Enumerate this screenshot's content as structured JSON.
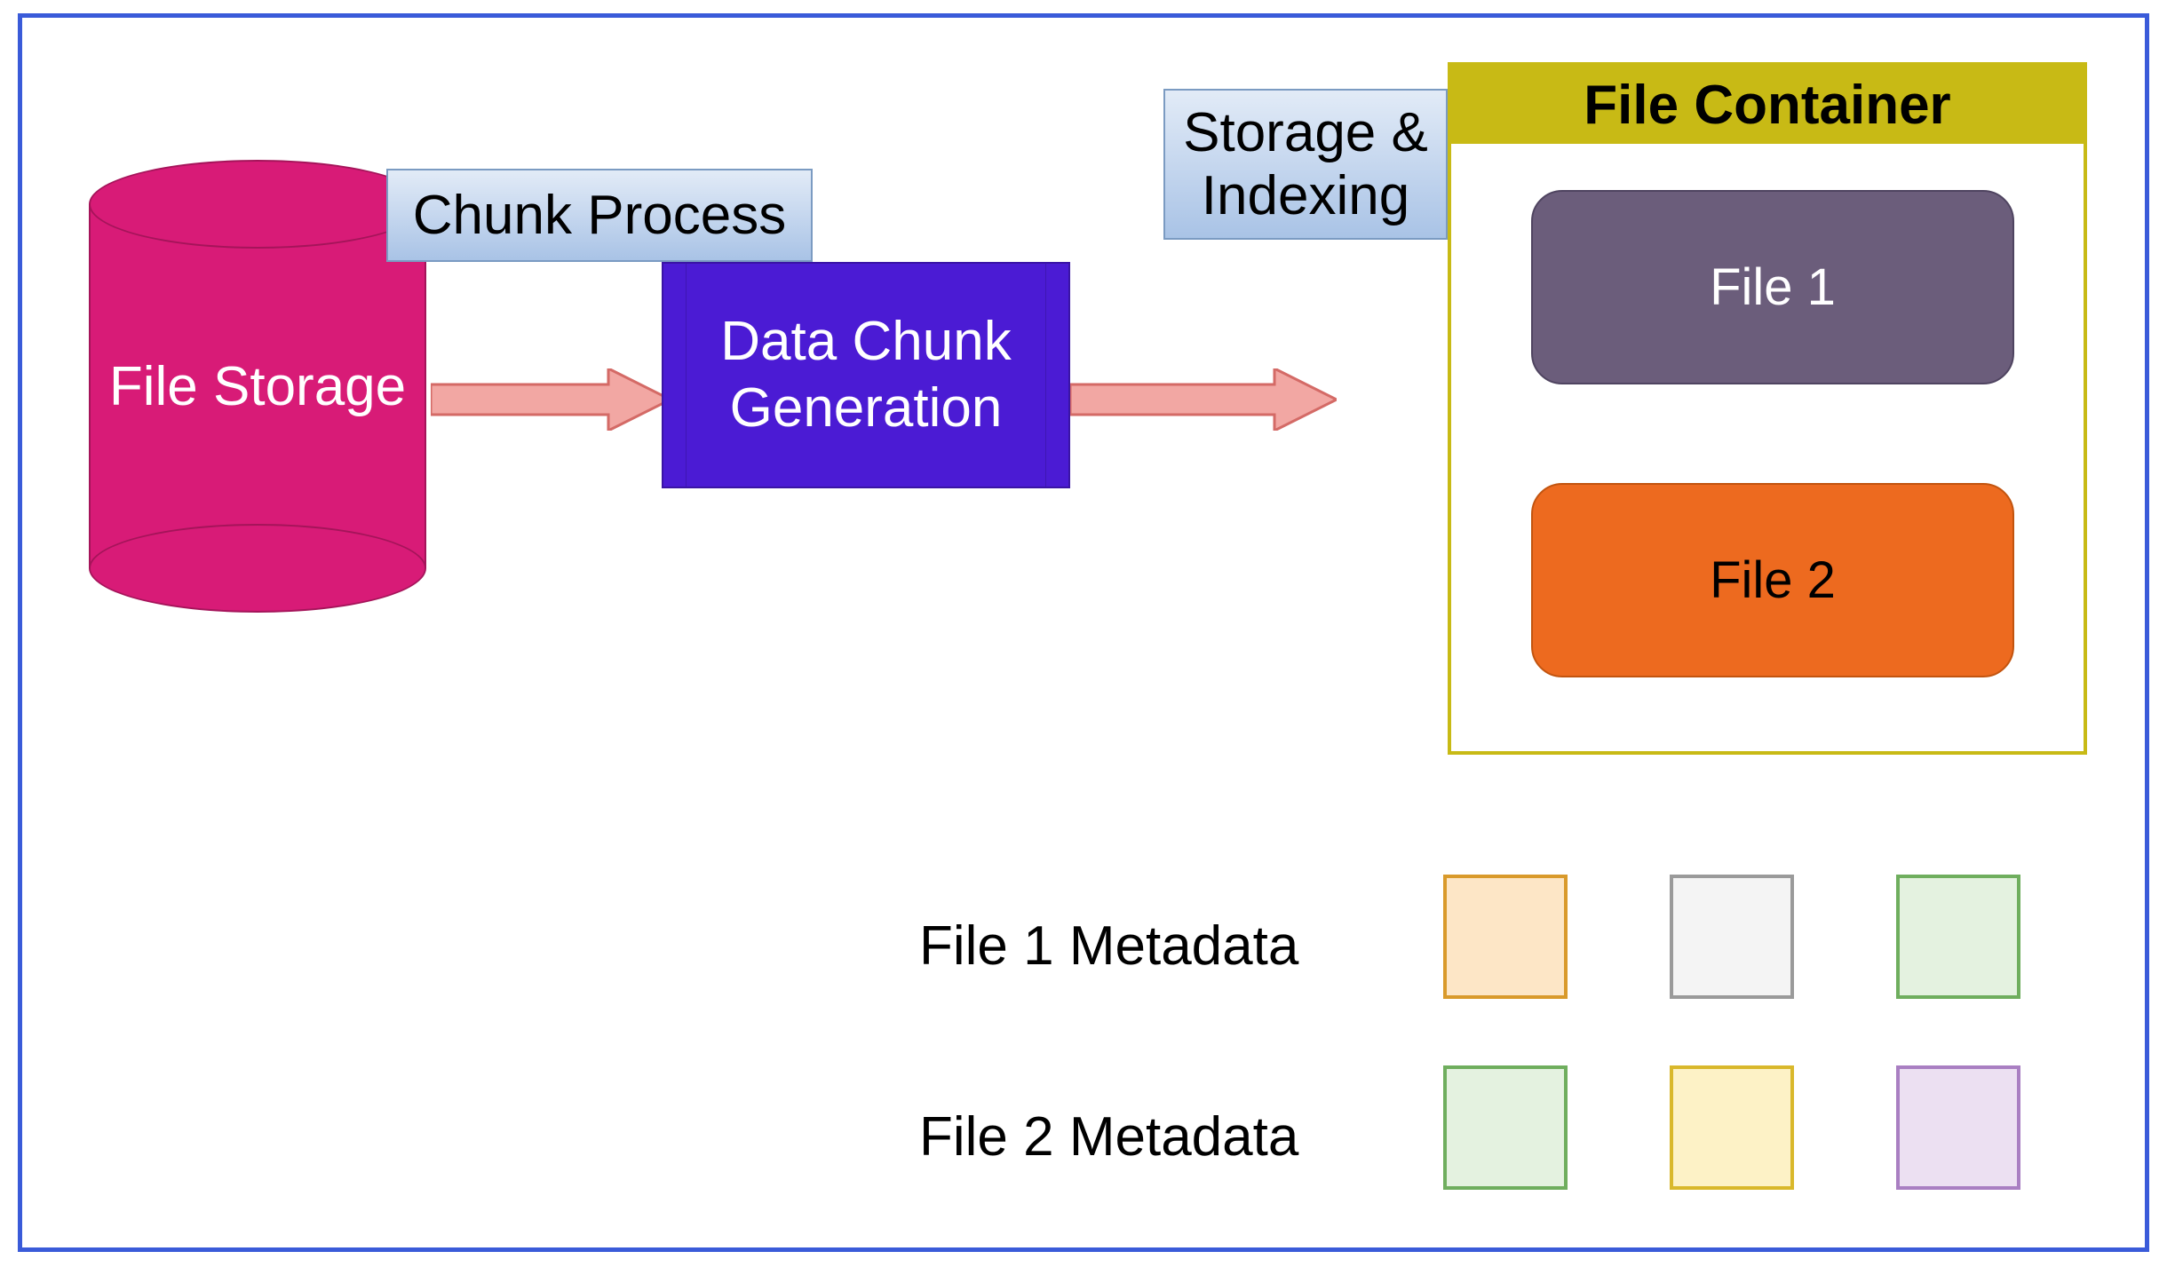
{
  "nodes": {
    "file_storage": "File Storage",
    "chunk_process": "Chunk Process",
    "data_chunk_generation": "Data Chunk\nGeneration",
    "storage_indexing": "Storage &\nIndexing",
    "file_container_title": "File Container",
    "file1": "File 1",
    "file2": "File 2"
  },
  "metadata": {
    "file1_label": "File 1 Metadata",
    "file2_label": "File 2 Metadata",
    "file1_swatches": [
      {
        "fill": "#fde6c6",
        "stroke": "#d99a2b"
      },
      {
        "fill": "#f4f4f4",
        "stroke": "#9a9a9a"
      },
      {
        "fill": "#e4f2e0",
        "stroke": "#6fae5e"
      }
    ],
    "file2_swatches": [
      {
        "fill": "#e4f2e0",
        "stroke": "#6fae5e"
      },
      {
        "fill": "#fdf2c6",
        "stroke": "#d9b82b"
      },
      {
        "fill": "#ece0f2",
        "stroke": "#a97fc2"
      }
    ]
  },
  "colors": {
    "cylinder": "#d81b77",
    "chunk_box": "#4b1bd4",
    "file_container_border": "#c8ba15",
    "file1_fill": "#6b5d7b",
    "file1_text": "#ffffff",
    "file2_fill": "#ed6a1f",
    "file2_text": "#000000",
    "arrow_fill": "#f2a7a3",
    "arrow_stroke": "#d46a66",
    "label_box_top": "#e2ebf7",
    "label_box_bottom": "#a9c3e6",
    "frame_border": "#3a5bd9"
  }
}
